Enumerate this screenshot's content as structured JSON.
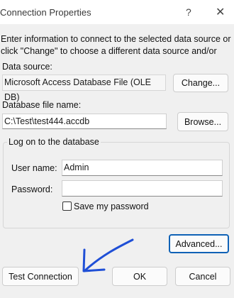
{
  "window": {
    "title": "Connection Properties",
    "help_glyph": "?",
    "close_glyph": "✕"
  },
  "instructions": "Enter information to connect to the selected data source or click \"Change\" to choose a different data source and/or",
  "data_source": {
    "label": "Data source:",
    "value": "Microsoft Access Database File (OLE DB)",
    "change_label": "Change..."
  },
  "database_file": {
    "label": "Database file name:",
    "value": "C:\\Test\\test444.accdb",
    "browse_label": "Browse..."
  },
  "logon": {
    "group_title": "Log on to the database",
    "user_name_label": "User name:",
    "user_name_value": "Admin",
    "password_label": "Password:",
    "password_value": "",
    "save_password_label": "Save my password",
    "save_password_checked": false
  },
  "buttons": {
    "advanced": "Advanced...",
    "test_connection": "Test Connection",
    "ok": "OK",
    "cancel": "Cancel"
  },
  "annotation": {
    "stroke_color": "#1f4fd6"
  }
}
